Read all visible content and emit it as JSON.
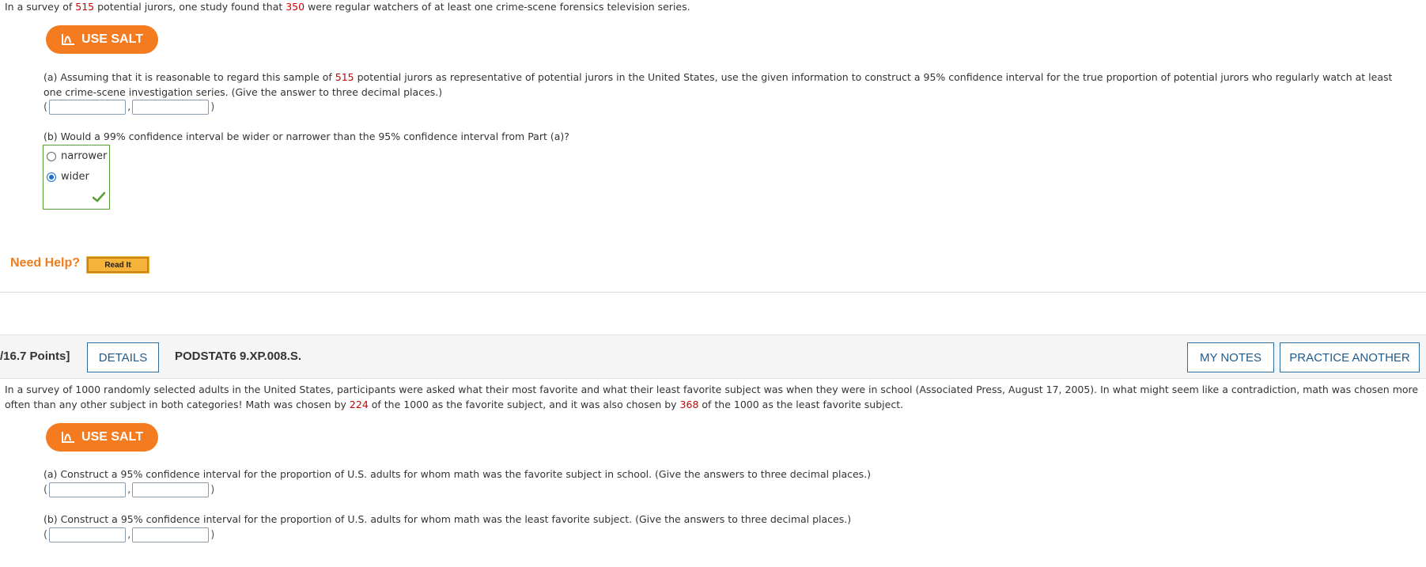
{
  "q1": {
    "intro": {
      "a": "In a survey of ",
      "n1": "515",
      "b": " potential jurors, one study found that ",
      "n2": "350",
      "c": " were regular watchers of at least one crime-scene forensics television series."
    },
    "salt_label": "USE SALT",
    "part_a": {
      "a": "(a) Assuming that it is reasonable to regard this sample of ",
      "n": "515",
      "b": " potential jurors as representative of potential jurors in the United States, use the given information to construct a 95% confidence interval for the true proportion of potential jurors who regularly watch at least one crime-scene investigation series. (Give the answer to three decimal places.)"
    },
    "interval": {
      "open": "(",
      "sep": ",",
      "close": ")",
      "lower": "",
      "upper": ""
    },
    "part_b": "(b) Would a 99% confidence interval be wider or narrower than the 95% confidence interval from Part (a)?",
    "options": [
      {
        "label": "narrower",
        "selected": false
      },
      {
        "label": "wider",
        "selected": true
      }
    ],
    "correct_color": "#5a9e3a",
    "need_help": "Need Help?",
    "read_it": "Read It"
  },
  "q2": {
    "points": "/16.7 Points]",
    "details": "DETAILS",
    "code": "PODSTAT6 9.XP.008.S.",
    "my_notes": "MY NOTES",
    "practice": "PRACTICE ANOTHER",
    "intro": {
      "a": "In a survey of 1000 randomly selected adults in the United States, participants were asked what their most favorite and what their least favorite subject was when they were in school (Associated Press, August 17, 2005). In what might seem like a contradiction, math was chosen more often than any other subject in both categories! Math was chosen by ",
      "n1": "224",
      "b": " of the 1000 as the favorite subject, and it was also chosen by ",
      "n2": "368",
      "c": " of the 1000 as the least favorite subject."
    },
    "salt_label": "USE SALT",
    "part_a": "(a) Construct a 95% confidence interval for the proportion of U.S. adults for whom math was the favorite subject in school. (Give the answers to three decimal places.)",
    "part_b": "(b) Construct a 95% confidence interval for the proportion of U.S. adults for whom math was the least favorite subject. (Give the answers to three decimal places.)",
    "interval": {
      "open": "(",
      "sep": ",",
      "close": ")"
    }
  },
  "colors": {
    "accent": "#f47b20",
    "link": "#215a8a",
    "highlight": "#cc0000"
  },
  "icons": {
    "salt": "salt-chart-icon",
    "check": "checkmark-icon"
  }
}
